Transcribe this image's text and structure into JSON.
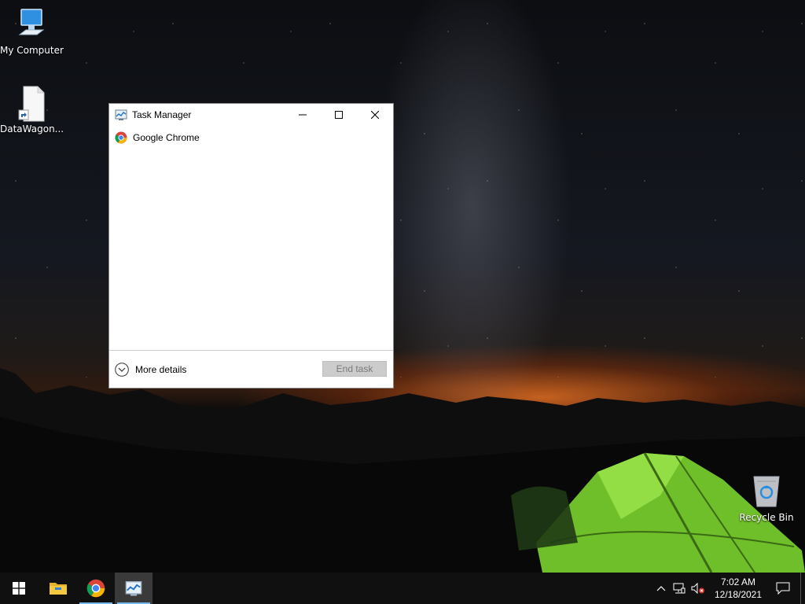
{
  "desktop": {
    "icons": [
      {
        "label": "My Computer"
      },
      {
        "label": "DataWagon..."
      },
      {
        "label": "Recycle Bin"
      }
    ]
  },
  "task_manager": {
    "title": "Task Manager",
    "apps": [
      {
        "label": "Google Chrome",
        "icon": "chrome-icon"
      }
    ],
    "more_details_label": "More details",
    "end_task_label": "End task"
  },
  "taskbar": {
    "items": [
      "start-icon",
      "file-explorer-icon",
      "chrome-icon",
      "task-manager-icon"
    ],
    "tray": {
      "time": "7:02 AM",
      "date": "12/18/2021"
    }
  },
  "colors": {
    "taskbar_bg": "#101010",
    "active_underline": "#76b9ed",
    "tent_green": "#7ed321",
    "sunset_orange": "#e06e23"
  }
}
